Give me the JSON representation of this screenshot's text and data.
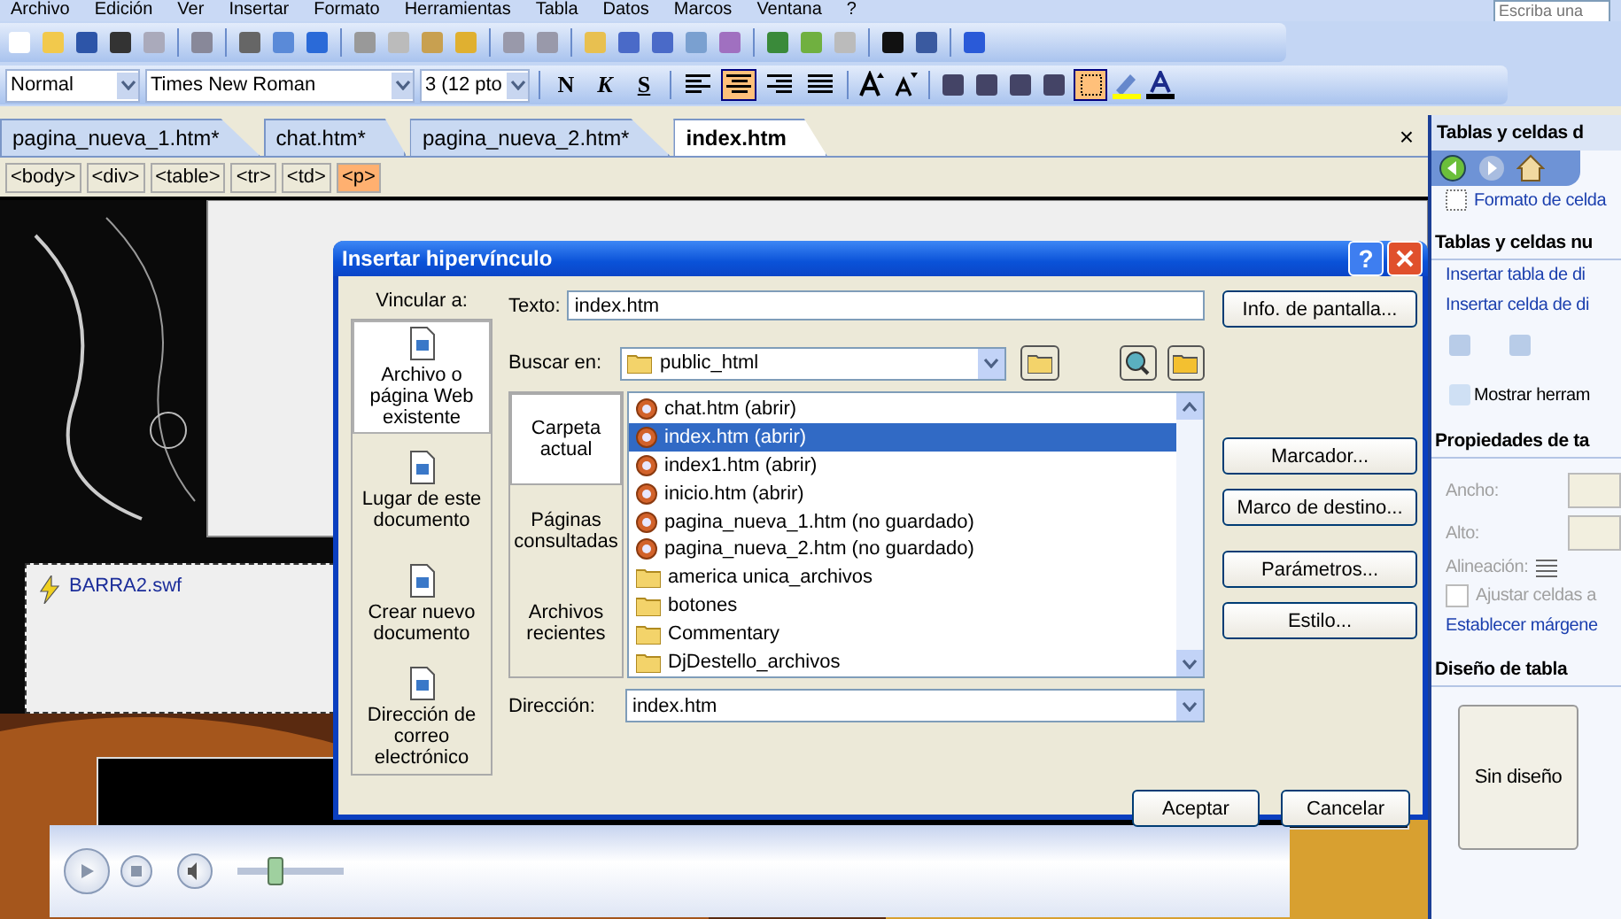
{
  "menu": [
    "Archivo",
    "Edición",
    "Ver",
    "Insertar",
    "Formato",
    "Herramientas",
    "Tabla",
    "Datos",
    "Marcos",
    "Ventana",
    "?"
  ],
  "help_search": {
    "placeholder": "Escriba una"
  },
  "formatting": {
    "style": "Normal",
    "font": "Times New Roman",
    "size": "3  (12 pto",
    "bold": "N",
    "italic": "K",
    "underline": "S",
    "align": [
      {
        "selected": false
      },
      {
        "selected": true
      },
      {
        "selected": false
      },
      {
        "selected": false
      }
    ],
    "borders_selected": true
  },
  "doc_tabs": [
    {
      "label": "pagina_nueva_1.htm*",
      "selected": false
    },
    {
      "label": "chat.htm*",
      "selected": false
    },
    {
      "label": "pagina_nueva_2.htm*",
      "selected": false
    },
    {
      "label": "index.htm",
      "selected": true
    }
  ],
  "close_tab": "×",
  "tag_bar": [
    {
      "label": "<body>",
      "selected": false
    },
    {
      "label": "<div>",
      "selected": false
    },
    {
      "label": "<table>",
      "selected": false
    },
    {
      "label": "<tr>",
      "selected": false
    },
    {
      "label": "<td>",
      "selected": false
    },
    {
      "label": "<p>",
      "selected": true
    }
  ],
  "document": {
    "flash_file": "BARRA2.swf",
    "player_volume": {
      "level": 0.35
    }
  },
  "dialog": {
    "title": "Insertar hipervínculo",
    "help": "?",
    "link_label": "Vincular a:",
    "link_targets": [
      {
        "label": "Archivo o página Web existente",
        "selected": true
      },
      {
        "label": "Lugar de este documento",
        "selected": false
      },
      {
        "label": "Crear nuevo documento",
        "selected": false
      },
      {
        "label": "Dirección de correo electrónico",
        "selected": false
      }
    ],
    "text_label": "Texto:",
    "text_value": "index.htm",
    "info_button": "Info. de pantalla...",
    "look_in_label": "Buscar en:",
    "look_in": "public_html",
    "sources": [
      {
        "label": "Carpeta actual",
        "selected": true
      },
      {
        "label": "Páginas consultadas",
        "selected": false
      },
      {
        "label": "Archivos recientes",
        "selected": false
      }
    ],
    "files": [
      {
        "name": "chat.htm (abrir)",
        "kind": "file",
        "selected": false
      },
      {
        "name": "index.htm (abrir)",
        "kind": "file",
        "selected": true
      },
      {
        "name": "index1.htm (abrir)",
        "kind": "file",
        "selected": false
      },
      {
        "name": "inicio.htm (abrir)",
        "kind": "file",
        "selected": false
      },
      {
        "name": "pagina_nueva_1.htm (no guardado)",
        "kind": "file",
        "selected": false
      },
      {
        "name": "pagina_nueva_2.htm (no guardado)",
        "kind": "file",
        "selected": false
      },
      {
        "name": "america unica_archivos",
        "kind": "folder",
        "selected": false
      },
      {
        "name": "botones",
        "kind": "folder",
        "selected": false
      },
      {
        "name": "Commentary",
        "kind": "folder",
        "selected": false
      },
      {
        "name": "DjDestello_archivos",
        "kind": "folder",
        "selected": false
      }
    ],
    "address_label": "Dirección:",
    "address": "index.htm",
    "side_buttons": [
      "Marcador...",
      "Marco de destino...",
      "Parámetros...",
      "Estilo..."
    ],
    "ok": "Aceptar",
    "cancel": "Cancelar"
  },
  "task_pane": {
    "title": "Tablas y celdas d",
    "format_link": "Formato de celda",
    "new_section": "Tablas y celdas nu",
    "links": [
      "Insertar tabla de di",
      "Insertar celda de di"
    ],
    "show_tools": "Mostrar herram",
    "props_section": "Propiedades de ta",
    "props": [
      "Ancho:",
      "Alto:",
      "Alineación:"
    ],
    "autofit": {
      "label": "Ajustar celdas a",
      "checked": false
    },
    "margins_link": "Establecer márgene",
    "design_section": "Diseño de tabla",
    "designs": [
      "Sin diseño"
    ]
  }
}
